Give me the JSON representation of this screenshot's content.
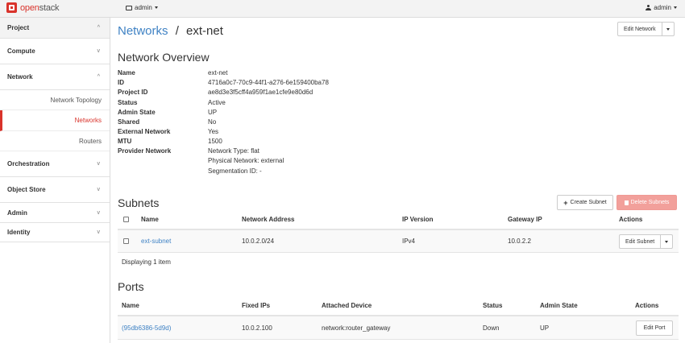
{
  "brand": {
    "name_prefix": "open",
    "name_suffix": "stack"
  },
  "topbar": {
    "project": "admin",
    "user": "admin"
  },
  "sidebar": {
    "sections": [
      {
        "label": "Project",
        "chevron": "^"
      },
      {
        "label": "Compute",
        "chevron": "v"
      },
      {
        "label": "Network",
        "chevron": "^"
      }
    ],
    "network_items": [
      {
        "label": "Network Topology"
      },
      {
        "label": "Networks"
      },
      {
        "label": "Routers"
      }
    ],
    "lower_sections": [
      {
        "label": "Orchestration",
        "chevron": "v"
      },
      {
        "label": "Object Store",
        "chevron": "v"
      },
      {
        "label": "Admin",
        "chevron": "v"
      },
      {
        "label": "Identity",
        "chevron": "v"
      }
    ]
  },
  "breadcrumb": {
    "parent": "Networks",
    "separator": "/",
    "current": "ext-net"
  },
  "header_actions": {
    "edit_network": "Edit Network"
  },
  "overview": {
    "title": "Network Overview",
    "rows": [
      {
        "key": "Name",
        "value": "ext-net"
      },
      {
        "key": "ID",
        "value": "4716a0c7-70c9-44f1-a276-6e159400ba78"
      },
      {
        "key": "Project ID",
        "value": "ae8d3e3f5cff4a959f1ae1cfe9e80d6d"
      },
      {
        "key": "Status",
        "value": "Active"
      },
      {
        "key": "Admin State",
        "value": "UP"
      },
      {
        "key": "Shared",
        "value": "No"
      },
      {
        "key": "External Network",
        "value": "Yes"
      },
      {
        "key": "MTU",
        "value": "1500"
      },
      {
        "key": "Provider Network",
        "value": "Network Type: flat"
      },
      {
        "key": "",
        "value": "Physical Network: external"
      },
      {
        "key": "",
        "value": "Segmentation ID: -"
      }
    ]
  },
  "subnets": {
    "title": "Subnets",
    "create_label": "Create Subnet",
    "delete_label": "Delete Subnets",
    "headers": {
      "name": "Name",
      "address": "Network Address",
      "ip_version": "IP Version",
      "gateway": "Gateway IP",
      "actions": "Actions"
    },
    "rows": [
      {
        "name": "ext-subnet",
        "address": "10.0.2.0/24",
        "ip_version": "IPv4",
        "gateway": "10.0.2.2",
        "action": "Edit Subnet"
      }
    ],
    "footer": "Displaying 1 item"
  },
  "ports": {
    "title": "Ports",
    "headers": {
      "name": "Name",
      "fixed_ips": "Fixed IPs",
      "device": "Attached Device",
      "status": "Status",
      "admin_state": "Admin State",
      "actions": "Actions"
    },
    "rows": [
      {
        "name": "(95db6386-5d9d)",
        "fixed_ips": "10.0.2.100",
        "device": "network:router_gateway",
        "status": "Down",
        "admin_state": "UP",
        "action": "Edit Port"
      }
    ]
  }
}
